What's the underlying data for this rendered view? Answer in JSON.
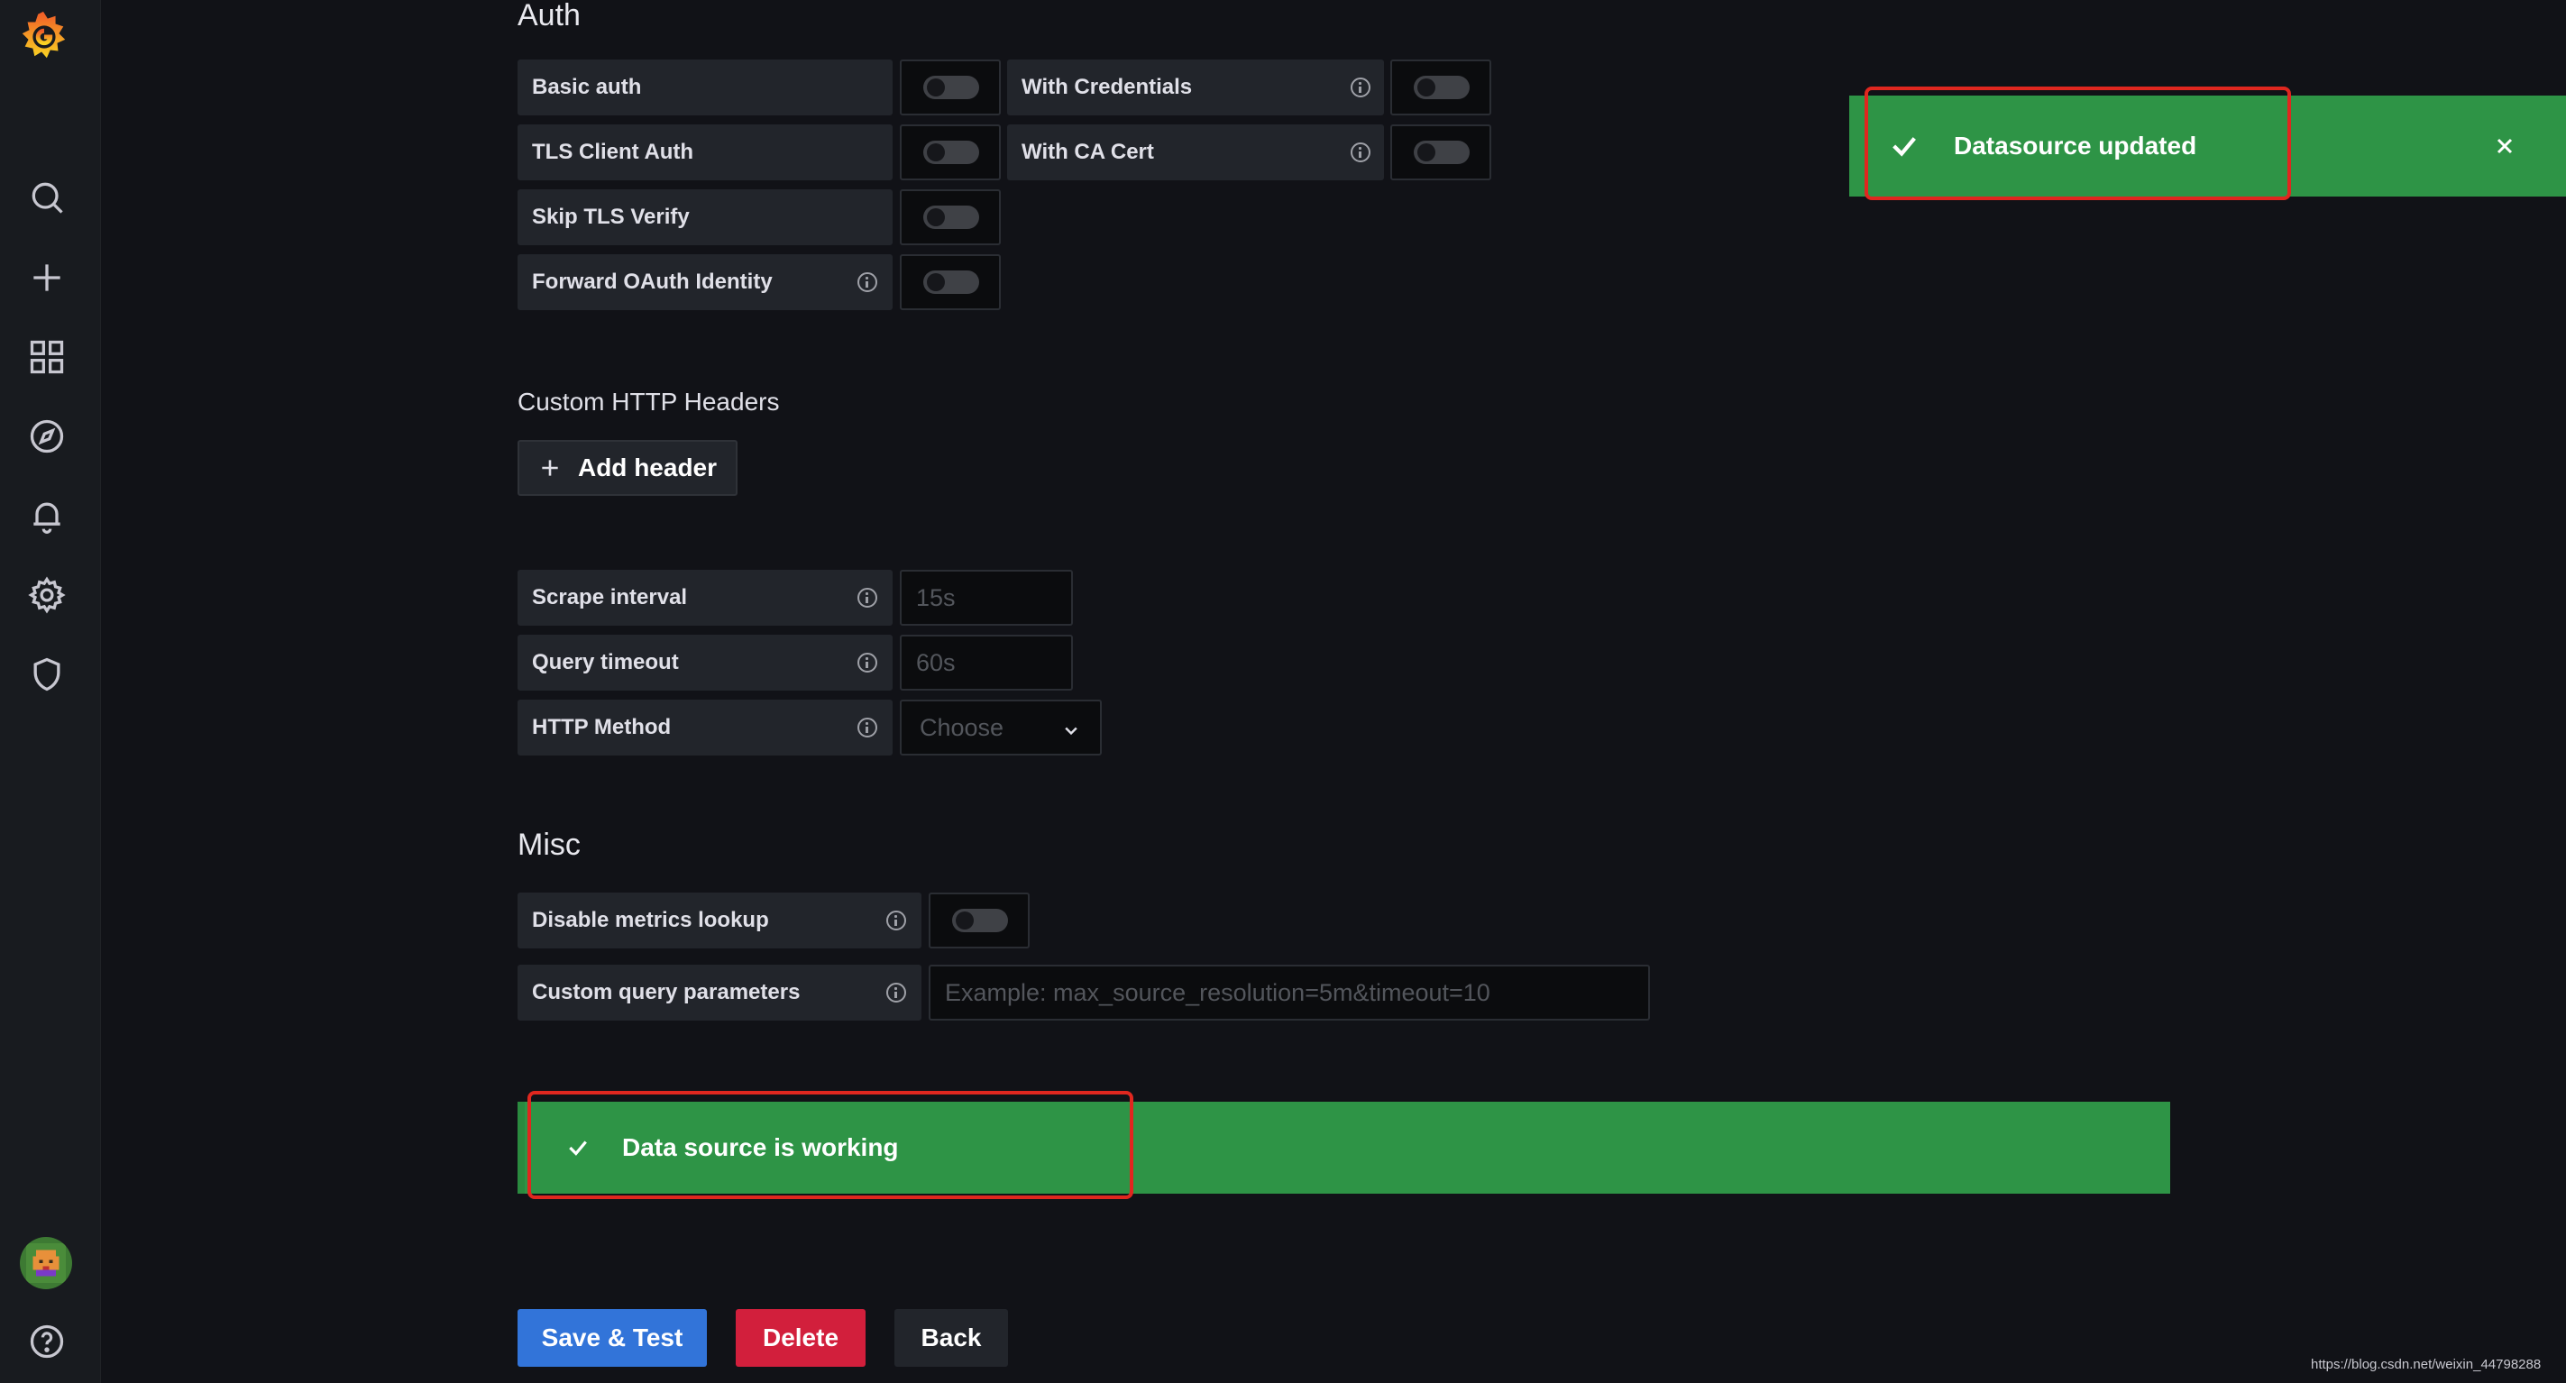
{
  "auth": {
    "title": "Auth",
    "basic_auth": "Basic auth",
    "tls_client_auth": "TLS Client Auth",
    "skip_tls_verify": "Skip TLS Verify",
    "forward_oauth": "Forward OAuth Identity",
    "with_credentials": "With Credentials",
    "with_ca_cert": "With CA Cert"
  },
  "headers": {
    "title": "Custom HTTP Headers",
    "add_label": "Add header"
  },
  "prometheus": {
    "scrape_interval_label": "Scrape interval",
    "scrape_interval_placeholder": "15s",
    "query_timeout_label": "Query timeout",
    "query_timeout_placeholder": "60s",
    "http_method_label": "HTTP Method",
    "http_method_value": "Choose"
  },
  "misc": {
    "title": "Misc",
    "disable_metrics_label": "Disable metrics lookup",
    "custom_query_label": "Custom query parameters",
    "custom_query_placeholder": "Example: max_source_resolution=5m&timeout=10"
  },
  "status": {
    "message": "Data source is working"
  },
  "toast": {
    "message": "Datasource updated"
  },
  "actions": {
    "save_test": "Save & Test",
    "delete": "Delete",
    "back": "Back"
  },
  "watermark": "https://blog.csdn.net/weixin_44798288",
  "colors": {
    "success": "#2f9e44",
    "primary": "#3274d9",
    "danger": "#d44a3a",
    "highlight": "#e0271f"
  },
  "icons": [
    "grafana-logo-icon",
    "search-icon",
    "plus-icon",
    "dashboards-icon",
    "explore-icon",
    "bell-icon",
    "gear-icon",
    "shield-icon",
    "help-icon",
    "check-icon",
    "close-icon",
    "info-icon",
    "chevron-down-icon"
  ]
}
